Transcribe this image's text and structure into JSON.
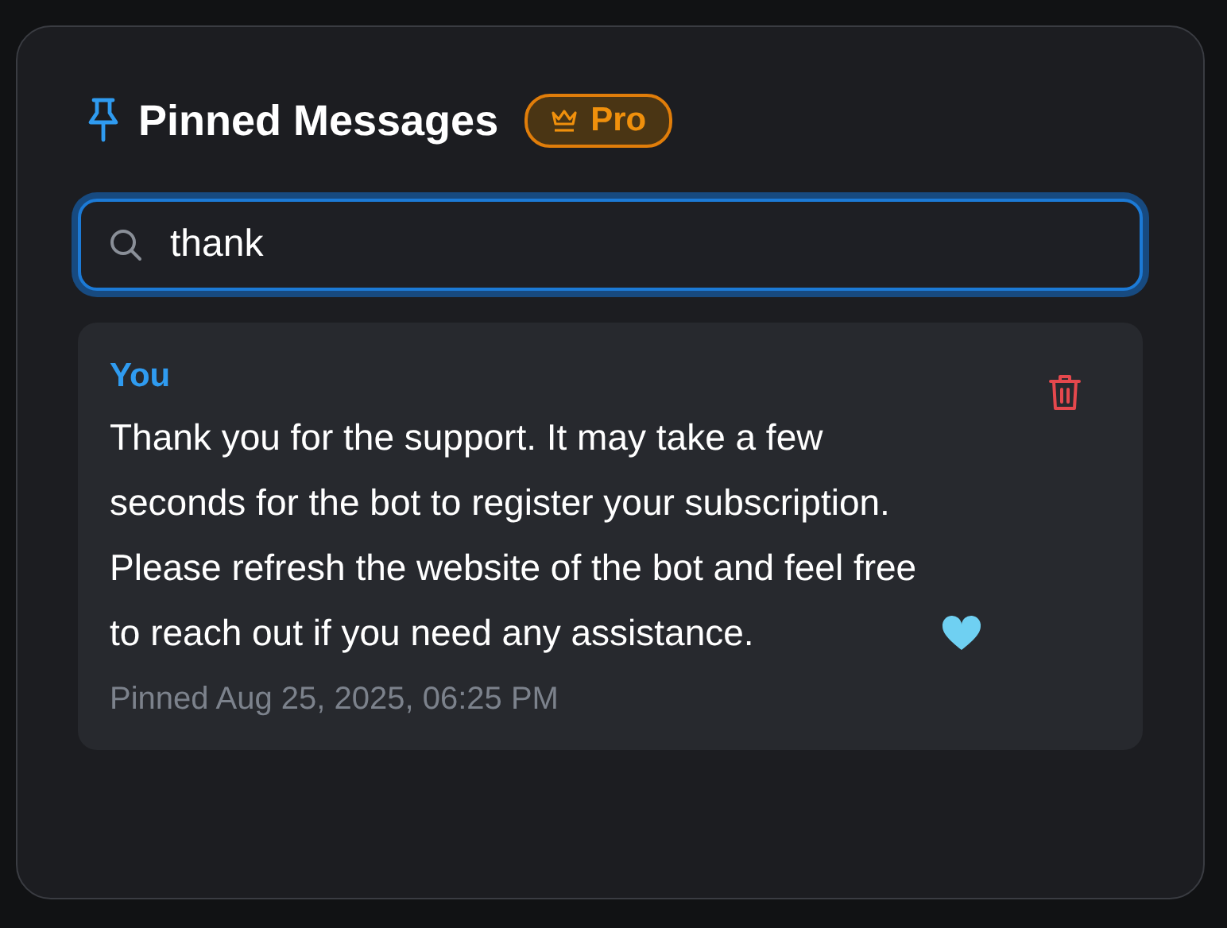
{
  "panel": {
    "title": "Pinned Messages",
    "badge": "Pro"
  },
  "search": {
    "value": "thank",
    "focused": true
  },
  "messages": [
    {
      "author": "You",
      "text": "Thank you for the support. It may take a few seconds for the bot to register your subscription. Please refresh the website of the bot and feel free to reach out if you need any assistance.",
      "pinned": "Pinned Aug 25, 2025, 06:25 PM"
    }
  ]
}
